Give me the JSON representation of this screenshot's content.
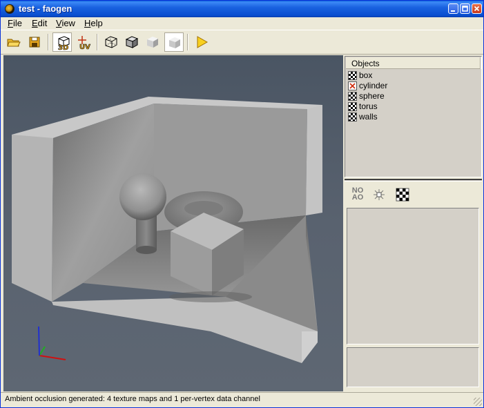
{
  "window": {
    "title": "test - faogen"
  },
  "menu": [
    {
      "key": "F",
      "rest": "ile"
    },
    {
      "key": "E",
      "rest": "dit"
    },
    {
      "key": "V",
      "rest": "iew"
    },
    {
      "key": "H",
      "rest": "elp"
    }
  ],
  "toolbar": {
    "view_3d_label": "3D",
    "view_uv_label": "UV",
    "icons": [
      "open-folder-icon",
      "save-disk-icon",
      "view-3d-icon",
      "view-uv-icon",
      "wireframe-cube-icon",
      "shaded-cube-icon",
      "textured-cube-icon",
      "ao-cube-icon",
      "play-icon"
    ]
  },
  "objects": {
    "header": "Objects",
    "items": [
      {
        "label": "box",
        "checked": true
      },
      {
        "label": "cylinder",
        "checked": false
      },
      {
        "label": "sphere",
        "checked": true
      },
      {
        "label": "torus",
        "checked": true
      },
      {
        "label": "walls",
        "checked": true
      }
    ]
  },
  "tools": {
    "noao_line1": "NO",
    "noao_line2": "AO"
  },
  "status": {
    "text": "Ambient occlusion generated: 4 texture maps and 1 per-vertex data channel"
  },
  "colors": {
    "titlebar": "#0a4fd0",
    "face": "#ece9d8",
    "panel": "#d4d0c8",
    "viewport_bg": "#59626f",
    "axis_x": "#d01010",
    "axis_y": "#20b020",
    "axis_z": "#2030d0"
  }
}
